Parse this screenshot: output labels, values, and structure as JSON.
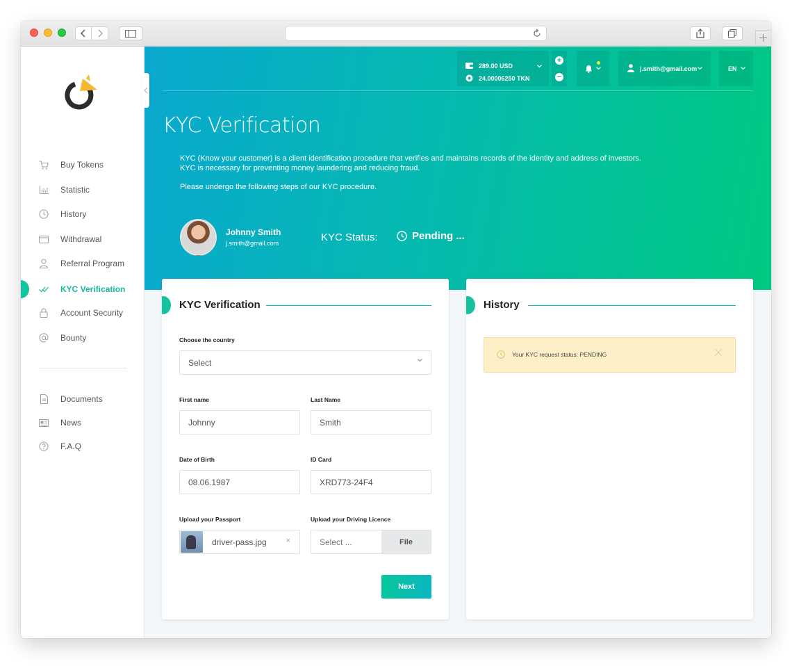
{
  "header": {
    "balance_usd": "289.00 USD",
    "balance_tkn": "24.00006250 TKN",
    "user_email": "j.smith@gmail.com",
    "language": "EN"
  },
  "sidebar": {
    "items": [
      {
        "label": "Buy Tokens",
        "icon": "cart-icon"
      },
      {
        "label": "Statistic",
        "icon": "chart-icon"
      },
      {
        "label": "History",
        "icon": "clock-icon"
      },
      {
        "label": "Withdrawal",
        "icon": "wallet-icon"
      },
      {
        "label": "Referral Program",
        "icon": "user-icon"
      },
      {
        "label": "KYC Verification",
        "icon": "double-check-icon"
      },
      {
        "label": "Account Security",
        "icon": "lock-icon"
      },
      {
        "label": "Bounty",
        "icon": "at-icon"
      }
    ],
    "secondary": [
      {
        "label": "Documents",
        "icon": "document-icon"
      },
      {
        "label": "News",
        "icon": "news-icon"
      },
      {
        "label": "F.A.Q",
        "icon": "help-icon"
      }
    ],
    "active": "KYC Verification"
  },
  "hero": {
    "title": "KYC Verification",
    "intro_line1": "KYC (Know your customer) is a client identification procedure that verifies and maintains records of the identity and address of investors.",
    "intro_line2": "KYC is necessary for preventing money laundering and reducing fraud.",
    "intro_line3": "Please undergo the following steps of our KYC procedure.",
    "user_name": "Johnny Smith",
    "user_email": "j.smith@gmail.com",
    "kyc_label": "KYC Status:",
    "kyc_status": "Pending ..."
  },
  "form": {
    "title": "KYC Verification",
    "country_label": "Choose the country",
    "country_value": "Select",
    "first_name_label": "First name",
    "first_name_value": "Johnny",
    "last_name_label": "Last Name",
    "last_name_value": "Smith",
    "dob_label": "Date of Birth",
    "dob_value": "08.06.1987",
    "id_label": "ID Card",
    "id_value": "XRD773-24F4",
    "passport_label": "Upload your Passport",
    "passport_file": "driver-pass.jpg",
    "licence_label": "Upload your Driving Licence",
    "licence_placeholder": "Select ...",
    "file_button": "File",
    "next_button": "Next"
  },
  "history": {
    "title": "History",
    "alert_text": "Your KYC request status:  PENDING"
  },
  "colors": {
    "accent": "#15c2a0",
    "hero_start": "#0aa8cf",
    "hero_end": "#00c981",
    "alert_bg": "#fdf0c8"
  }
}
